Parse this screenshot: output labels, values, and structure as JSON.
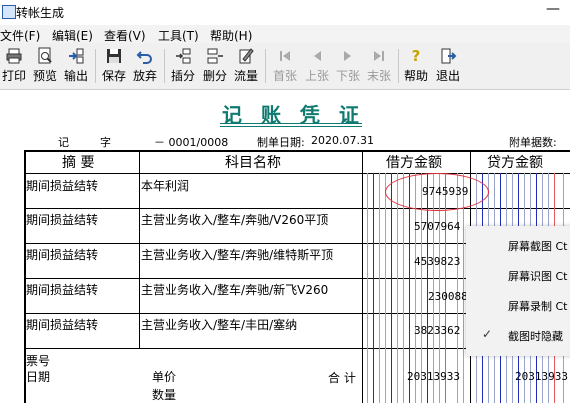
{
  "window": {
    "title": "转帐生成",
    "min_glyph": "—"
  },
  "menu": [
    "文件(F)",
    "编辑(E)",
    "查看(V)",
    "工具(T)",
    "帮助(H)"
  ],
  "toolbar": {
    "print": "打印",
    "preview": "预览",
    "export": "输出",
    "save": "保存",
    "discard": "放弃",
    "insert": "插分",
    "delete": "删分",
    "flow": "流量",
    "first": "首张",
    "prev": "上张",
    "next": "下张",
    "last": "末张",
    "help": "帮助",
    "exit": "退出"
  },
  "voucher": {
    "title": "记 账 凭 证",
    "type_label": "记",
    "type_suffix": "字",
    "number": "－ 0001/0008",
    "date_label": "制单日期:",
    "date": "2020.07.31",
    "attachments_label": "附单据数:"
  },
  "table": {
    "headers": {
      "summary": "摘 要",
      "account": "科目名称",
      "debit": "借方金额",
      "credit": "贷方金额"
    },
    "rows": [
      {
        "summary": "期间损益结转",
        "account": "本年利润",
        "amount": "9745939"
      },
      {
        "summary": "期间损益结转",
        "account": "主营业务收入/整车/奔驰/V260平顶",
        "amount": "5707964"
      },
      {
        "summary": "期间损益结转",
        "account": "主营业务收入/整车/奔驰/维特斯平顶",
        "amount": "4539823"
      },
      {
        "summary": "期间损益结转",
        "account": "主营业务收入/整车/奔驰/新飞V260",
        "amount": "230088"
      },
      {
        "summary": "期间损益结转",
        "account": "主营业务收入/整车/丰田/塞纳",
        "amount": "3823362"
      }
    ],
    "footer": {
      "ticket_label": "票号",
      "date_label": "日期",
      "price_label": "单价",
      "qty_label": "数量",
      "total_label": "合 计",
      "debit_total": "20313933",
      "credit_total": "20313933"
    }
  },
  "context_menu": {
    "items": [
      "屏幕截图 Ct",
      "屏幕识图 Ct",
      "屏幕录制 Ct",
      "截图时隐藏"
    ],
    "checked_index": 3
  },
  "colors": {
    "title_teal": "#107a70",
    "debit_red": "#e25a5a",
    "grid_blue": "#1f2fb8",
    "annotation_red": "#e0303a"
  }
}
